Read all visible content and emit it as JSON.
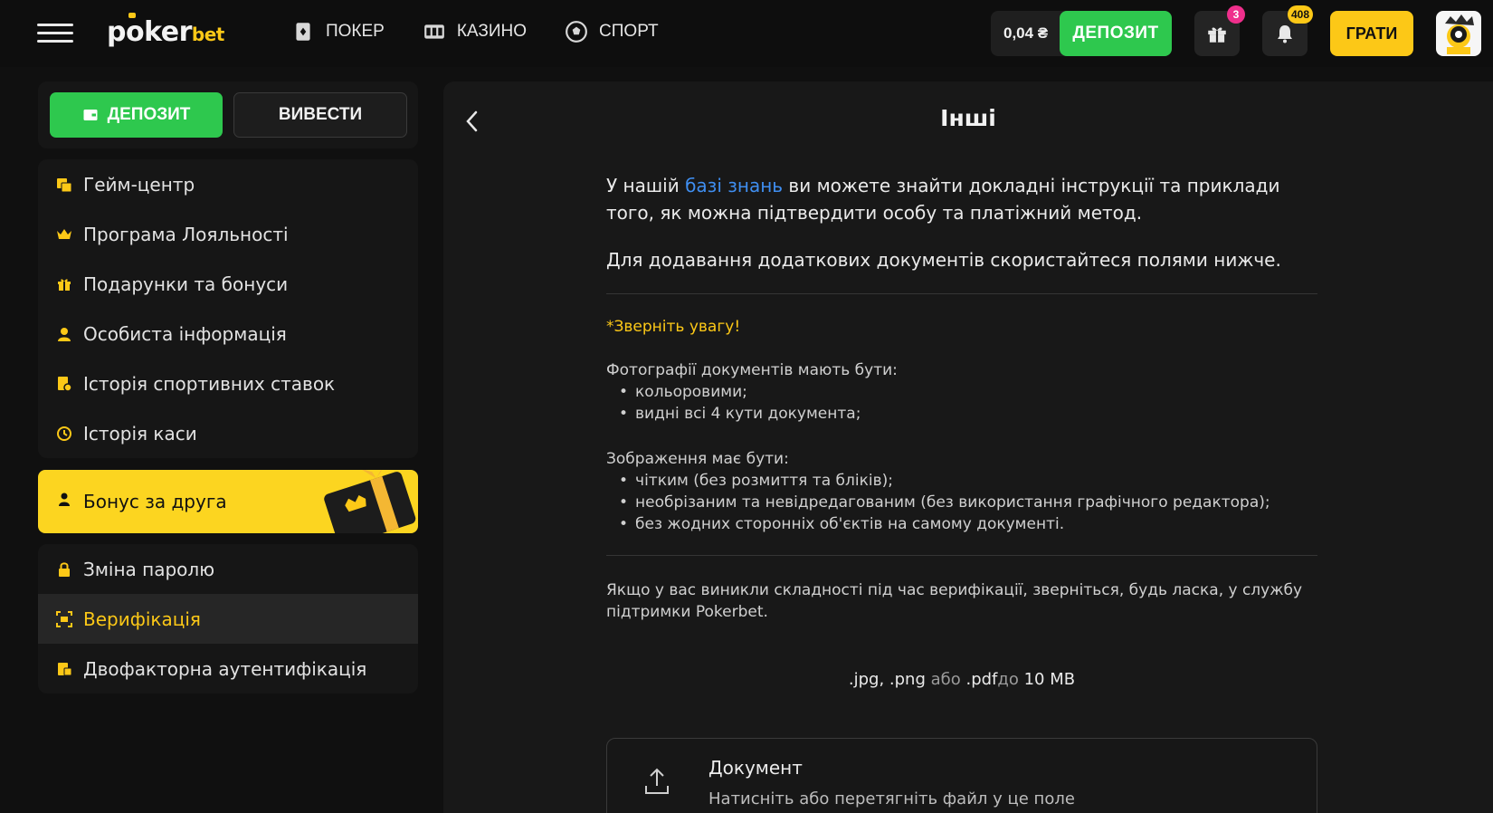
{
  "header": {
    "logo_part1": "p",
    "logo_ring": "o",
    "logo_part2": "ker",
    "logo_part3": "bet",
    "nav": [
      {
        "label": "ПОКЕР",
        "icon": "poker-card-icon"
      },
      {
        "label": "КАЗИНО",
        "icon": "slot-machine-icon"
      },
      {
        "label": "СПОРТ",
        "icon": "soccer-ball-icon"
      }
    ],
    "balance": "0,04 ₴",
    "deposit_label": "ДЕПОЗИТ",
    "gifts_badge": "3",
    "notifications_badge": "408",
    "play_label": "ГРАТИ"
  },
  "sidebar": {
    "deposit_label": "ДЕПОЗИТ",
    "withdraw_label": "ВИВЕСТИ",
    "menu_group1": [
      {
        "label": "Гейм-центр",
        "icon": "game-center-icon"
      },
      {
        "label": "Програма Лояльності",
        "icon": "crown-icon"
      },
      {
        "label": "Подарунки та бонуси",
        "icon": "gift-icon"
      },
      {
        "label": "Особиста інформація",
        "icon": "user-icon"
      },
      {
        "label": "Історія спортивних ставок",
        "icon": "bet-history-icon"
      },
      {
        "label": "Історія каси",
        "icon": "history-icon"
      }
    ],
    "bonus_banner": "Бонус за друга",
    "menu_group2": [
      {
        "label": "Зміна паролю",
        "icon": "lock-icon"
      },
      {
        "label": "Верифікація",
        "icon": "verification-icon"
      },
      {
        "label": "Двофакторна аутентифікація",
        "icon": "two-factor-icon"
      }
    ]
  },
  "main": {
    "title": "Інші",
    "intro_before": "У нашій ",
    "intro_link": "базі знань",
    "intro_after": " ви можете знайти докладні інструкції та приклади того, як можна підтвердити особу та платіжний метод.",
    "additional": "Для додавання додаткових документів скористайтеся полями нижче.",
    "note": "*Зверніть увагу!",
    "photos_heading": "Фотографії документів мають бути:",
    "photos_items": [
      "кольоровими;",
      "видні всі 4 кути документа;"
    ],
    "image_heading": "Зображення має бути:",
    "image_items": [
      "чітким (без розмиття та бліків);",
      "необрізаним та невідредагованим (без використання графічного редактора);",
      "без жодних сторонніх об'єктів на самому документі."
    ],
    "support_text": "Якщо у вас виникли складності під час верифікації, зверніться, будь ласка, у службу підтримки Pokerbet.",
    "formats_a": ".jpg, .png",
    "formats_or": " або ",
    "formats_b": ".pdf",
    "formats_to": "до ",
    "formats_size": "10 MB",
    "upload_title": "Документ",
    "upload_hint": "Натисніть або перетягніть файл у це поле"
  },
  "colors": {
    "accent_yellow": "#fcc817",
    "green": "#2ec84e",
    "link_blue": "#3f8ef0",
    "badge_pink": "#ef2f8c"
  }
}
